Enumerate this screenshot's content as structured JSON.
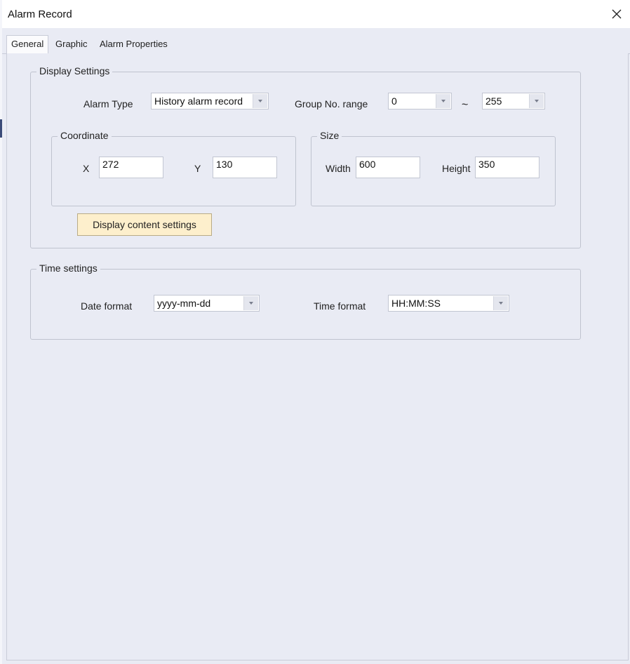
{
  "window": {
    "title": "Alarm Record"
  },
  "tabs": [
    {
      "label": "General",
      "active": true
    },
    {
      "label": "Graphic",
      "active": false
    },
    {
      "label": "Alarm Properties",
      "active": false
    }
  ],
  "display_settings": {
    "legend": "Display Settings",
    "alarm_type_label": "Alarm Type",
    "alarm_type_value": "History alarm record",
    "group_range_label": "Group No. range",
    "group_from": "0",
    "range_sep": "~",
    "group_to": "255",
    "coordinate": {
      "legend": "Coordinate",
      "x_label": "X",
      "x_value": "272",
      "y_label": "Y",
      "y_value": "130"
    },
    "size": {
      "legend": "Size",
      "width_label": "Width",
      "width_value": "600",
      "height_label": "Height",
      "height_value": "350"
    },
    "content_button": "Display content settings"
  },
  "time_settings": {
    "legend": "Time settings",
    "date_format_label": "Date format",
    "date_format_value": "yyyy-mm-dd",
    "time_format_label": "Time format",
    "time_format_value": "HH:MM:SS"
  },
  "colors": {
    "background": "#e9ebf4",
    "button_bg": "#fdefcc",
    "titlebar": "#ffffff"
  },
  "icons": {
    "close": "close-icon",
    "dropdown": "chevron-down-icon"
  }
}
